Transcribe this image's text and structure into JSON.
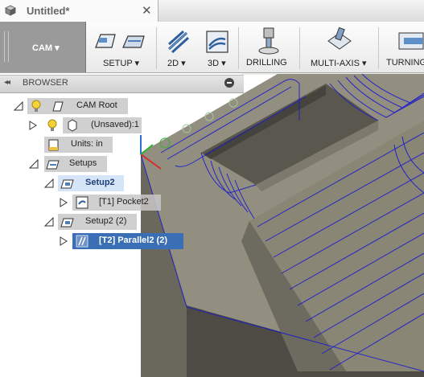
{
  "document": {
    "title": "Untitled*",
    "close_glyph": "✕"
  },
  "toolbar": {
    "workspace_label": "CAM ▾",
    "groups": [
      {
        "label": "SETUP ▾",
        "icon": "setup-icon"
      },
      {
        "label": "2D ▾",
        "icon": "2d-icon"
      },
      {
        "label": "3D ▾",
        "icon": "3d-icon"
      },
      {
        "label": "DRILLING",
        "icon": "drilling-icon"
      },
      {
        "label": "MULTI-AXIS ▾",
        "icon": "multi-axis-icon"
      },
      {
        "label": "TURNING",
        "icon": "turning-icon"
      }
    ]
  },
  "browser": {
    "title": "BROWSER",
    "collapse_glyph": "◂◂",
    "tree": [
      {
        "label": "CAM Root",
        "icon": "lightbulb-icon"
      },
      {
        "label": "(Unsaved):1",
        "icon": "lightbulb-icon"
      },
      {
        "label": "Units: in",
        "icon": "units-icon"
      },
      {
        "label": "Setups",
        "icon": "folder-icon"
      },
      {
        "label": "Setup2",
        "icon": "setup-folder-icon"
      },
      {
        "label": "[T1] Pocket2",
        "icon": "pocket-icon"
      },
      {
        "label": "Setup2 (2)",
        "icon": "setup-folder-icon"
      },
      {
        "label": "[T2] Parallel2 (2)",
        "icon": "parallel-icon"
      }
    ]
  },
  "colors": {
    "toolpath": "#1a1acc",
    "part_top": "#8e8a7c",
    "part_side": "#6f6c62",
    "selection": "#3b6fb5"
  }
}
